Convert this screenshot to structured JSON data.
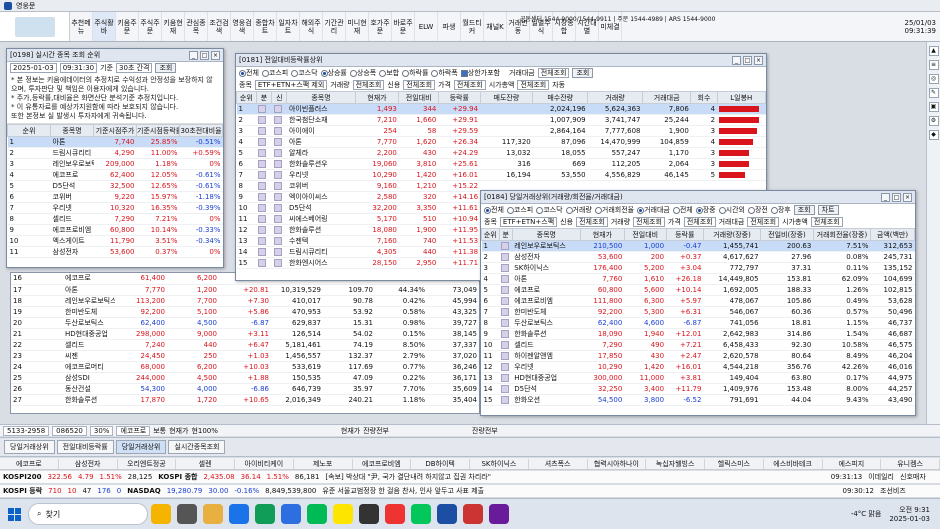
{
  "app": {
    "title": "영웅문",
    "brand_color": "#1c4ea3",
    "up_color": "#d9141c",
    "down_color": "#1a3fd1"
  },
  "header": {
    "phones": "공동센터 1544-9000/1544-9911 | 주문 1544-4989 | ARS 1544-9000",
    "date": "25/01/03",
    "time": "09:31:39"
  },
  "toolbar": [
    "추천메뉴",
    "주식활바",
    "키움주문",
    "주식주문",
    "키움현재",
    "관심종목",
    "조건검색",
    "영웅검색",
    "종합차트",
    "일자차트",
    "해외주식",
    "기간관리",
    "미니현재",
    "호가주문",
    "바로주문",
    "ELW",
    "파생",
    "월드티커",
    "채널K",
    "거래변동",
    "일별주식",
    "시장종합",
    "시간대별",
    "미체결"
  ],
  "win_top_left": {
    "title": "[0198] 실시간 종목 조회 순위",
    "date": "2025-01-03",
    "time": "09:31:30",
    "label_base": "기준",
    "interval": "30초 간격",
    "btn": "조회",
    "notice": [
      "* 본 정보는 키움에데이터의 추정치로 수익성과 안정성을 보장하지 않으며, 투자판단 및 책임은 이용자에게 있습니다.",
      "* 주가,등락률,대비율은 화면산단 분석기준 추정치입니다.",
      "* 이 유통자료를 예상가지원함에 따라 보호되지 않습니다.",
      "  또한 본정보 실 발생시 투자자에게 귀속됩니다."
    ],
    "cols": [
      "순위",
      "종목명",
      "기준시점주가",
      "기준시점등락률",
      "30초전대비율"
    ],
    "rows": [
      [
        "1",
        "아톤",
        "7,740",
        "25.85%",
        "-0.51%"
      ],
      [
        "2",
        "드림시큐리티",
        "4,290",
        "11.00%",
        "+0.59%"
      ],
      [
        "3",
        "레인보우로보틱스",
        "209,000",
        "1.18%",
        "0%"
      ],
      [
        "4",
        "에코프로",
        "62,400",
        "12.05%",
        "-0.61%"
      ],
      [
        "5",
        "D5단석",
        "32,500",
        "12.65%",
        "-0.61%"
      ],
      [
        "6",
        "코위버",
        "9,220",
        "15.97%",
        "-1.18%"
      ],
      [
        "7",
        "우리넷",
        "10,320",
        "16.35%",
        "-0.39%"
      ],
      [
        "8",
        "셀리드",
        "7,290",
        "7.21%",
        "0%"
      ],
      [
        "9",
        "에코프로비엠",
        "60,800",
        "10.14%",
        "-0.33%"
      ],
      [
        "10",
        "엑스게이트",
        "11,790",
        "3.51%",
        "-0.34%"
      ],
      [
        "11",
        "삼성전자",
        "53,600",
        "0.37%",
        "0%"
      ]
    ]
  },
  "win_mid": {
    "title": "[0181] 전일대비등락률상위",
    "filters1": [
      "전체",
      "코스피",
      "코스닥",
      "상승률",
      "상승폭",
      "보합",
      "하락률",
      "하락폭",
      "상한가포함"
    ],
    "btn_query": "조회",
    "market_label": "거래대금",
    "market_val": "전체조회",
    "filters2": {
      "label1": "종목",
      "sel1": "ETF+ETN+스팩 제외",
      "label2": "거래량",
      "sel2": "전체조회",
      "label3": "신용",
      "sel3": "전체조회",
      "label4": "가격",
      "sel4": "전체조회",
      "label5": "시가총액",
      "sel5": "전체조회",
      "auto": "자동"
    },
    "cols": [
      "순위",
      "분",
      "신",
      "종목명",
      "현재가",
      "전일대비",
      "등락률",
      "매도잔량",
      "매수잔량",
      "거래량",
      "거래대금",
      "회수",
      "L일봉H"
    ],
    "rows": [
      [
        "1",
        "",
        "",
        "아이빈플러스",
        "1,493",
        "344",
        "+29.94",
        "",
        "2,024,196",
        "5,624,363",
        "7,806",
        "4"
      ],
      [
        "2",
        "",
        "",
        "한국첨단소재",
        "7,210",
        "1,660",
        "+29.91",
        "",
        "1,007,909",
        "3,741,747",
        "25,244",
        "2"
      ],
      [
        "3",
        "",
        "",
        "아이에이",
        "254",
        "58",
        "+29.59",
        "",
        "2,864,164",
        "7,777,608",
        "1,900",
        "3"
      ],
      [
        "4",
        "",
        "",
        "아톤",
        "7,770",
        "1,620",
        "+26.34",
        "117,320",
        "87,096",
        "14,470,999",
        "104,859",
        "4"
      ],
      [
        "5",
        "",
        "",
        "알체라",
        "2,200",
        "430",
        "+24.29",
        "13,032",
        "18,055",
        "557,247",
        "1,170",
        "3"
      ],
      [
        "6",
        "",
        "",
        "한화솔루션우",
        "19,060",
        "3,810",
        "+25.61",
        "316",
        "669",
        "112,205",
        "2,064",
        "3"
      ],
      [
        "7",
        "",
        "",
        "우리넷",
        "10,290",
        "1,420",
        "+16.01",
        "16,194",
        "53,550",
        "4,556,829",
        "46,145",
        "5"
      ],
      [
        "8",
        "",
        "",
        "코위버",
        "9,160",
        "1,210",
        "+15.22",
        "",
        "",
        "",
        "",
        ""
      ],
      [
        "9",
        "",
        "",
        "엑이아이씨스",
        "2,580",
        "320",
        "+14.16",
        "",
        "",
        "",
        "",
        ""
      ],
      [
        "10",
        "",
        "",
        "D5단석",
        "32,200",
        "3,350",
        "+11.61",
        "",
        "",
        "",
        "",
        ""
      ],
      [
        "11",
        "",
        "",
        "씨에스베어링",
        "5,170",
        "510",
        "+10.94",
        "",
        "",
        "",
        "",
        ""
      ],
      [
        "12",
        "",
        "",
        "한화솔루션",
        "18,080",
        "1,900",
        "+11.95",
        "",
        "",
        "",
        "",
        ""
      ],
      [
        "13",
        "",
        "",
        "수젠텍",
        "7,160",
        "740",
        "+11.53",
        "",
        "",
        "",
        "",
        ""
      ],
      [
        "14",
        "",
        "",
        "드림시큐리티",
        "4,305",
        "440",
        "+11.38",
        "",
        "",
        "",
        "",
        ""
      ],
      [
        "15",
        "",
        "",
        "한화엔시어스",
        "28,150",
        "2,950",
        "+11.71",
        "",
        "",
        "",
        "",
        ""
      ]
    ]
  },
  "win_right": {
    "title": "[0184] 당일거래상위(거래량/회전율/거래대금)",
    "filters1": [
      "전체",
      "코스피",
      "코스닥",
      "거래량",
      "거래회전율",
      "거래대금",
      "전체",
      "장중",
      "시간외",
      "장전",
      "장후"
    ],
    "btn": "조회",
    "btn2": "차트",
    "filters2": {
      "label1": "종목",
      "sel1": "ETF+ETN+스팩",
      "label2": "신용",
      "sel2": "전체조회",
      "label3": "거래량",
      "sel3": "전체조회",
      "label4": "가격",
      "sel4": "전체조회",
      "label5": "거래대금",
      "sel5": "전체조회",
      "label6": "시가총액",
      "sel6": "전체조회"
    },
    "cols": [
      "순위",
      "분",
      "종목명",
      "현재가",
      "전일대비",
      "등락률",
      "거래량(장중)",
      "전일비(장중)",
      "거래회전율(장중)",
      "금액(백만)"
    ],
    "rows": [
      [
        "1",
        "",
        "레인보우로보틱스",
        "210,500",
        "1,000",
        "-0.47",
        "1,455,741",
        "200.63",
        "7.51%",
        "312,653"
      ],
      [
        "2",
        "",
        "삼성전자",
        "53,600",
        "200",
        "+0.37",
        "4,617,627",
        "27.96",
        "0.08%",
        "245,731"
      ],
      [
        "3",
        "",
        "SK하이닉스",
        "176,400",
        "5,200",
        "+3.04",
        "772,797",
        "37.31",
        "0.11%",
        "135,152"
      ],
      [
        "4",
        "",
        "아톤",
        "7,760",
        "1,610",
        "+26.18",
        "14,449,805",
        "153.81",
        "62.09%",
        "104,699"
      ],
      [
        "5",
        "",
        "에코프로",
        "60,800",
        "5,600",
        "+10.14",
        "1,692,005",
        "188.33",
        "1.26%",
        "102,815"
      ],
      [
        "6",
        "",
        "에코프로비엠",
        "111,800",
        "6,300",
        "+5.97",
        "478,067",
        "105.86",
        "0.49%",
        "53,628"
      ],
      [
        "7",
        "",
        "한미반도체",
        "92,200",
        "5,300",
        "+6.31",
        "546,067",
        "60.36",
        "0.57%",
        "50,496"
      ],
      [
        "8",
        "",
        "두산로보틱스",
        "62,400",
        "4,600",
        "-6.87",
        "741,056",
        "18.81",
        "1.15%",
        "46,737"
      ],
      [
        "9",
        "",
        "한화솔루션",
        "18,090",
        "1,940",
        "+12.01",
        "2,642,983",
        "314.86",
        "1.54%",
        "46,687"
      ],
      [
        "10",
        "",
        "셀리드",
        "7,290",
        "490",
        "+7.21",
        "6,458,433",
        "92.30",
        "10.58%",
        "46,575"
      ],
      [
        "11",
        "",
        "하이젠알앤엠",
        "17,850",
        "430",
        "+2.47",
        "2,620,578",
        "80.64",
        "8.49%",
        "46,204"
      ],
      [
        "12",
        "",
        "우리넷",
        "10,290",
        "1,420",
        "+16.01",
        "4,544,218",
        "356.76",
        "42.26%",
        "46,016"
      ],
      [
        "13",
        "",
        "HD현대중공업",
        "300,000",
        "11,000",
        "+3.81",
        "149,404",
        "63.80",
        "0.17%",
        "44,975"
      ],
      [
        "14",
        "",
        "D5단석",
        "32,250",
        "3,400",
        "+11.79",
        "1,409,976",
        "153.48",
        "8.00%",
        "44,257"
      ],
      [
        "15",
        "",
        "한화오션",
        "54,500",
        "3,800",
        "-6.52",
        "791,691",
        "44.04",
        "9.43%",
        "43,490"
      ]
    ]
  },
  "win_lower": {
    "cols": [
      "",
      "종목명",
      "현재가",
      "전일대비",
      "등락률",
      "거래량",
      "거래대금",
      "회전율",
      "금액"
    ],
    "rows": [
      [
        "16",
        "에코프로",
        "61,400",
        "6,200",
        "+11.23",
        "",
        "",
        "",
        ""
      ],
      [
        "17",
        "아톤",
        "7,770",
        "1,200",
        "+20.81",
        "10,319,529",
        "109.70",
        "44.34%",
        "73,049"
      ],
      [
        "18",
        "레인보우로보틱스",
        "113,200",
        "7,700",
        "+7.30",
        "410,017",
        "90.78",
        "0.42%",
        "45,994"
      ],
      [
        "19",
        "한미반도체",
        "92,200",
        "5,100",
        "+5.86",
        "470,953",
        "53.92",
        "0.58%",
        "43,325"
      ],
      [
        "20",
        "두산로보틱스",
        "62,400",
        "4,500",
        "-6.87",
        "629,837",
        "15.31",
        "0.98%",
        "39,727"
      ],
      [
        "21",
        "HD현대중공업",
        "298,000",
        "9,000",
        "+3.11",
        "126,514",
        "54.02",
        "0.15%",
        "38,145"
      ],
      [
        "22",
        "셀리드",
        "7,240",
        "440",
        "+6.47",
        "5,181,461",
        "74.19",
        "8.50%",
        "37,337"
      ],
      [
        "23",
        "씨젠",
        "24,450",
        "250",
        "+1.03",
        "1,456,557",
        "132.37",
        "2.79%",
        "37,020"
      ],
      [
        "24",
        "에코프로머티",
        "68,000",
        "6,200",
        "+10.03",
        "533,619",
        "117.69",
        "0.77%",
        "36,246"
      ],
      [
        "25",
        "삼성SDI",
        "244,000",
        "4,500",
        "+1.88",
        "150,535",
        "47.09",
        "0.22%",
        "36,171"
      ],
      [
        "26",
        "동산건설",
        "54,300",
        "4,000",
        "-6.86",
        "646,739",
        "35.97",
        "7.70%",
        "35,609"
      ],
      [
        "27",
        "한화솔루션",
        "17,870",
        "1,720",
        "+10.65",
        "2,016,349",
        "240.21",
        "1.18%",
        "35,404"
      ]
    ]
  },
  "status_line": {
    "code": "5133-2958",
    "code2": "086520",
    "pct": "30%",
    "name": "에코프로",
    "label1": "보통",
    "label2": "현재가",
    "label3": "현100%",
    "label4": "현재가",
    "label5": "잔량전부",
    "label6": "잔량전부"
  },
  "window_tabs": [
    "당일거래상위",
    "전일대비등락률",
    "당일거래상위",
    "실시간종목조회"
  ],
  "ticker": [
    "에코프로",
    "삼성전자",
    "오리엔트정공",
    "셀렌",
    "아이비티케이",
    "제노포",
    "에코프로비엠",
    "DB하이텍",
    "SK하이닉스",
    "셔츠폭스",
    "협력시아하나이",
    "녹십자웰빙스",
    "헬릭스미스",
    "에스비바테크",
    "에스피지",
    "유니켐스"
  ],
  "index1": {
    "k1": "KOSPI200",
    "v1": "322.56",
    "c1": "4.79",
    "p1": "1.51%",
    "x1": "28,125",
    "k2": "KOSPI 종합",
    "v2": "2,435.08",
    "c2": "36.14",
    "p2": "1.51%",
    "x2": "86,181",
    "news": "[속보] 박상대 \"尹, 국가 결단내려 하지않고 집권 차리라\"",
    "t": "09:31:13",
    "f": "이데일리",
    "src": "신호매자"
  },
  "index2": {
    "k1": "KOSPI 등락",
    "a1": "710",
    "a2": "10",
    "a3": "47",
    "a4": "176",
    "a5": "0",
    "k2": "NASDAQ",
    "v2": "19,280.79",
    "c2": "30.00",
    "p2": "-0.16%",
    "x2": "8,849,539,800",
    "news": "유준 서울교범정장 한 걸음 찬사, 인사 앞두고 사표 제출",
    "t": "09:30:12",
    "f": "조선비즈"
  },
  "taskbar": {
    "search": "찾기",
    "weather": "-4°C 맑음",
    "time": "오전 9:31",
    "date": "2025-01-03"
  }
}
